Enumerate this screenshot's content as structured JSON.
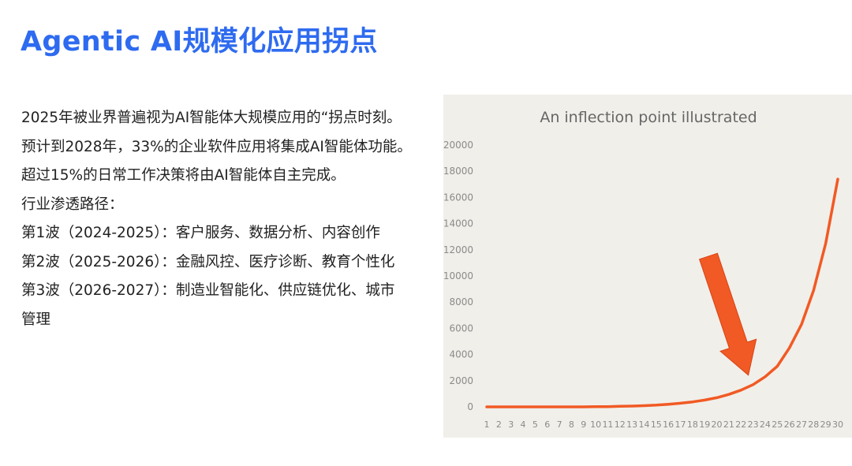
{
  "slide": {
    "title": "Agentic AI规模化应用拐点",
    "lines": [
      "2025年被业界普遍视为AI智能体大规模应用的“拐点时刻。",
      "预计到2028年，33%的企业软件应用将集成AI智能体功能。",
      "超过15%的日常工作决策将由AI智能体自主完成。",
      "行业渗透路径：",
      "第1波（2024-2025）：客户服务、数据分析、内容创作",
      "第2波（2025-2026）：金融风控、医疗诊断、教育个性化",
      "第3波（2026-2027）：制造业智能化、供应链优化、城市",
      "管理"
    ]
  },
  "chart_data": {
    "type": "line",
    "title": "An inflection point illustrated",
    "x": [
      1,
      2,
      3,
      4,
      5,
      6,
      7,
      8,
      9,
      10,
      11,
      12,
      13,
      14,
      15,
      16,
      17,
      18,
      19,
      20,
      21,
      22,
      23,
      24,
      25,
      26,
      27,
      28,
      29,
      30
    ],
    "series": [
      {
        "values": [
          0,
          0,
          0,
          0,
          0,
          0,
          0,
          0,
          0,
          10,
          20,
          40,
          60,
          90,
          130,
          200,
          280,
          380,
          520,
          700,
          950,
          1280,
          1700,
          2300,
          3100,
          4500,
          6300,
          8900,
          12500,
          17400
        ]
      }
    ],
    "yticks": [
      0,
      2000,
      4000,
      6000,
      8000,
      10000,
      12000,
      14000,
      16000,
      18000,
      20000
    ],
    "ylim": [
      0,
      20000
    ],
    "xlabel": "",
    "ylabel": "",
    "grid": false,
    "colors": {
      "line": "#f15a24",
      "arrow": "#f15a24",
      "title": "#666666",
      "ticks": "#8a8a8a"
    },
    "annotation": {
      "type": "arrow",
      "points_to_x": 23
    }
  }
}
